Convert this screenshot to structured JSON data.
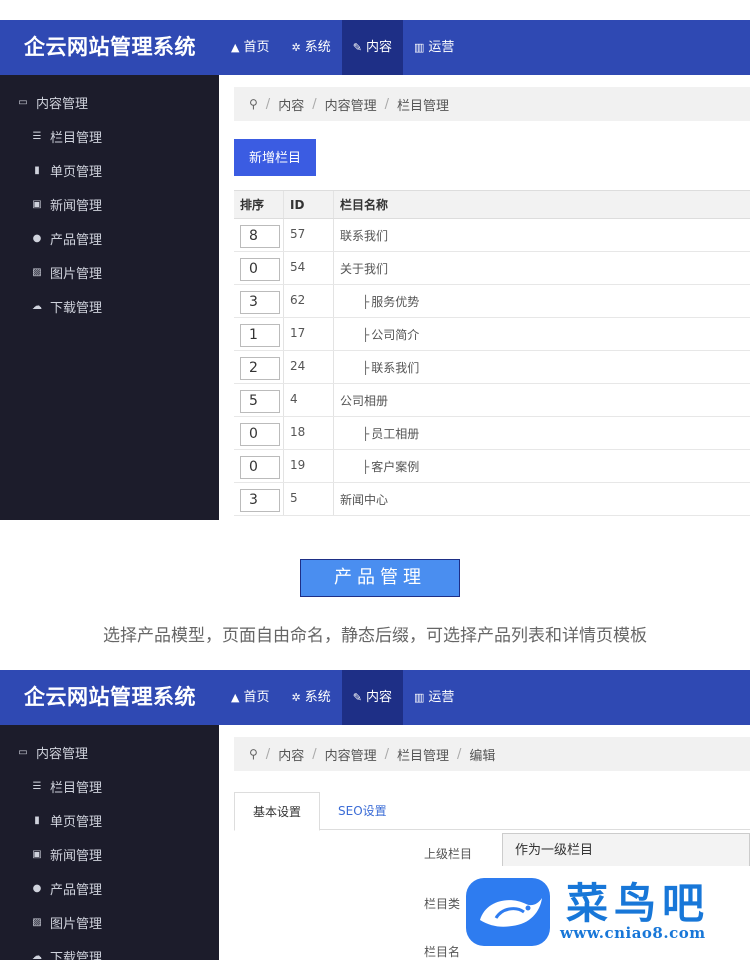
{
  "header": {
    "brand": "企云网站管理系统",
    "nav": [
      {
        "icon": "home-icon",
        "label": "首页",
        "active": false
      },
      {
        "icon": "gears-icon",
        "label": "系统",
        "active": false
      },
      {
        "icon": "edit-icon",
        "label": "内容",
        "active": true
      },
      {
        "icon": "bar-chart-icon",
        "label": "运营",
        "active": false
      }
    ]
  },
  "sidebar": {
    "head": {
      "icon": "folder-open-icon",
      "label": "内容管理"
    },
    "items": [
      {
        "icon": "list-icon",
        "label": "栏目管理"
      },
      {
        "icon": "file-icon",
        "label": "单页管理"
      },
      {
        "icon": "newspaper-icon",
        "label": "新闻管理"
      },
      {
        "icon": "product-icon",
        "label": "产品管理"
      },
      {
        "icon": "image-icon",
        "label": "图片管理"
      },
      {
        "icon": "cloud-download-icon",
        "label": "下载管理"
      }
    ]
  },
  "screen1": {
    "breadcrumb": [
      "内容",
      "内容管理",
      "栏目管理"
    ],
    "add_button": "新增栏目",
    "table": {
      "headers": [
        "排序",
        "ID",
        "栏目名称"
      ],
      "rows": [
        {
          "sort": "8",
          "id": "57",
          "name": "联系我们",
          "child": false
        },
        {
          "sort": "0",
          "id": "54",
          "name": "关于我们",
          "child": false
        },
        {
          "sort": "3",
          "id": "62",
          "name": "服务优势",
          "child": true
        },
        {
          "sort": "1",
          "id": "17",
          "name": "公司简介",
          "child": true
        },
        {
          "sort": "2",
          "id": "24",
          "name": "联系我们",
          "child": true
        },
        {
          "sort": "5",
          "id": "4",
          "name": "公司相册",
          "child": false
        },
        {
          "sort": "0",
          "id": "18",
          "name": "员工相册",
          "child": true
        },
        {
          "sort": "0",
          "id": "19",
          "name": "客户案例",
          "child": true
        },
        {
          "sort": "3",
          "id": "5",
          "name": "新闻中心",
          "child": false
        }
      ]
    }
  },
  "caption": {
    "tag": "产品管理",
    "description": "选择产品模型，页面自由命名，静态后缀，可选择产品列表和详情页模板"
  },
  "screen2": {
    "breadcrumb": [
      "内容",
      "内容管理",
      "栏目管理",
      "编辑"
    ],
    "tabs": [
      "基本设置",
      "SEO设置"
    ],
    "form": {
      "parent_label": "上级栏目",
      "parent_value": "作为一级栏目",
      "type_label": "栏目类",
      "name_label": "栏目名"
    }
  },
  "watermark": {
    "title": "菜鸟吧",
    "url": "www.cniao8.com"
  },
  "colors": {
    "topbar": "#2f49b3",
    "nav_active": "#1e2f86",
    "sidebar": "#1c1c2b",
    "primary_button": "#3b5ce2",
    "caption_tag": "#4a8ef0",
    "watermark": "#1877d8"
  }
}
